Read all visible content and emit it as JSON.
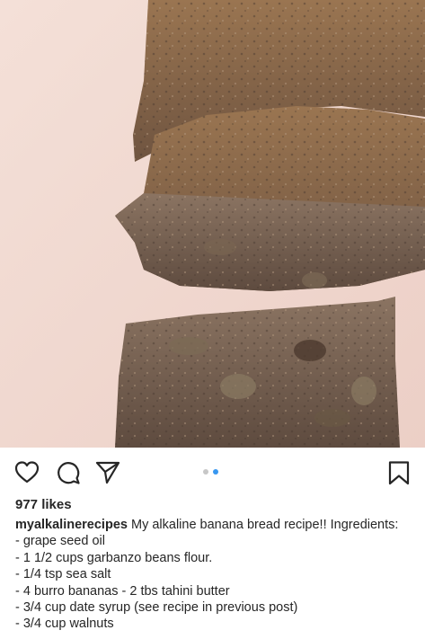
{
  "post": {
    "image": {
      "subject": "banana-bread-photo"
    },
    "actions": {
      "like_icon": "heart-icon",
      "comment_icon": "comment-icon",
      "share_icon": "paper-plane-icon",
      "save_icon": "bookmark-icon"
    },
    "carousel": {
      "total": 2,
      "active_index": 2,
      "active_color": "#3897f0",
      "inactive_color": "#c7c7c7"
    },
    "likes_text": "977 likes",
    "caption": {
      "username": "myalkalinerecipes",
      "text": "My alkaline banana bread recipe!! Ingredients:",
      "lines": [
        "- grape seed oil",
        "- 1 1/2 cups garbanzo beans flour.",
        "- 1/4 tsp sea salt",
        "- 4 burro bananas - 2 tbs tahini butter",
        "- 3/4 cup date syrup (see recipe in previous post)",
        "- 3/4 cup walnuts"
      ]
    }
  }
}
